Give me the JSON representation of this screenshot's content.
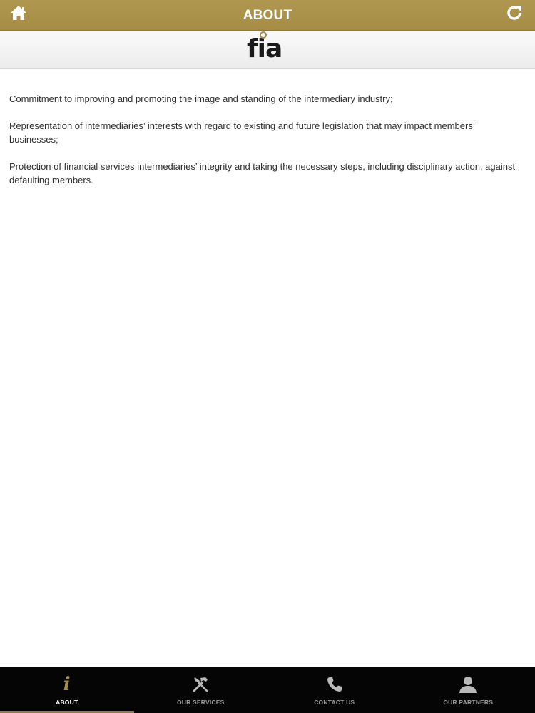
{
  "header": {
    "title": "ABOUT",
    "home_icon": "home-icon",
    "refresh_icon": "refresh-icon",
    "accent_color": "#a68c44"
  },
  "logo": {
    "text": "fia"
  },
  "content": {
    "paragraphs": [
      "Commitment to improving and promoting the image and standing of the intermediary industry;",
      "Representation of intermediaries’ interests with regard to existing and future legislation that may impact members’ businesses;",
      "Protection of financial services intermediaries’ integrity and taking the necessary steps, including disciplinary action, against defaulting members."
    ]
  },
  "tabs": [
    {
      "label": "ABOUT",
      "icon": "info-icon",
      "active": true
    },
    {
      "label": "OUR SERVICES",
      "icon": "tools-icon",
      "active": false
    },
    {
      "label": "CONTACT US",
      "icon": "phone-icon",
      "active": false
    },
    {
      "label": "OUR PARTNERS",
      "icon": "person-icon",
      "active": false
    }
  ]
}
